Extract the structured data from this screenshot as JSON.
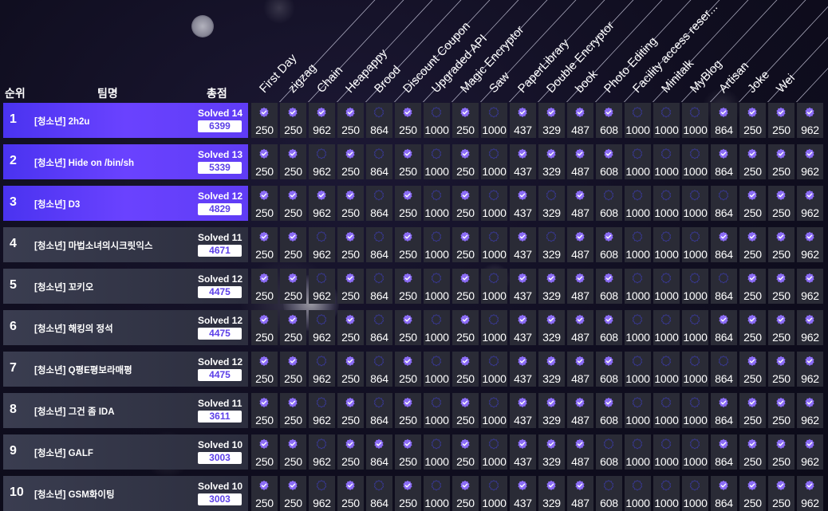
{
  "headers": {
    "rank": "순위",
    "team": "팀명",
    "score": "총점"
  },
  "challenges": [
    "First Day",
    "zigzag",
    "Chain",
    "Heapappy",
    "Brood",
    "Discount Coupon",
    "Upgraded API",
    "Magic Encryptor",
    "Saw",
    "PaperLibrary",
    "Double Encryptor",
    "book",
    "Photo Editing",
    "Facility access reser...",
    "Minitalk",
    "MyBlog",
    "Artisan",
    "Joke",
    "Wei"
  ],
  "points": [
    "250",
    "250",
    "962",
    "250",
    "864",
    "250",
    "1000",
    "250",
    "1000",
    "437",
    "329",
    "487",
    "608",
    "1000",
    "1000",
    "1000",
    "864",
    "250",
    "250",
    "962"
  ],
  "teams": [
    {
      "rank": "1",
      "name": "[청소년] 2h2u",
      "solved": "Solved 14",
      "score": "6399",
      "top": true,
      "solves": [
        1,
        1,
        1,
        1,
        0,
        1,
        0,
        1,
        0,
        1,
        1,
        1,
        1,
        0,
        0,
        0,
        1,
        1,
        1,
        1
      ]
    },
    {
      "rank": "2",
      "name": "[청소년] Hide on /bin/sh",
      "solved": "Solved 13",
      "score": "5339",
      "top": true,
      "solves": [
        1,
        1,
        0,
        1,
        0,
        1,
        0,
        1,
        0,
        1,
        1,
        1,
        1,
        0,
        0,
        0,
        1,
        1,
        1,
        1
      ]
    },
    {
      "rank": "3",
      "name": "[청소년] D3",
      "solved": "Solved 12",
      "score": "4829",
      "top": true,
      "solves": [
        1,
        1,
        1,
        1,
        0,
        1,
        0,
        1,
        0,
        1,
        0,
        1,
        0,
        0,
        0,
        0,
        0,
        1,
        1,
        1
      ]
    },
    {
      "rank": "4",
      "name": "[청소년] 마법소녀의시크릿익스",
      "solved": "Solved 11",
      "score": "4671",
      "top": false,
      "solves": [
        1,
        1,
        0,
        1,
        0,
        1,
        0,
        1,
        0,
        1,
        0,
        1,
        1,
        0,
        0,
        0,
        1,
        1,
        1,
        1
      ]
    },
    {
      "rank": "5",
      "name": "[청소년] 꼬키오",
      "solved": "Solved 12",
      "score": "4475",
      "top": false,
      "solves": [
        1,
        1,
        0,
        1,
        0,
        1,
        0,
        1,
        0,
        1,
        1,
        1,
        1,
        0,
        0,
        0,
        0,
        1,
        1,
        1
      ]
    },
    {
      "rank": "6",
      "name": "[청소년] 해킹의 정석",
      "solved": "Solved 12",
      "score": "4475",
      "top": false,
      "solves": [
        1,
        1,
        0,
        1,
        0,
        1,
        0,
        1,
        0,
        1,
        1,
        1,
        1,
        0,
        0,
        0,
        1,
        1,
        1,
        1
      ]
    },
    {
      "rank": "7",
      "name": "[청소년] Q평E평보라매평",
      "solved": "Solved 12",
      "score": "4475",
      "top": false,
      "solves": [
        1,
        1,
        0,
        1,
        0,
        1,
        0,
        1,
        0,
        1,
        1,
        1,
        1,
        0,
        0,
        0,
        0,
        1,
        1,
        1
      ]
    },
    {
      "rank": "8",
      "name": "[청소년] 그건 좀 IDA",
      "solved": "Solved 11",
      "score": "3611",
      "top": false,
      "solves": [
        1,
        1,
        0,
        1,
        0,
        1,
        0,
        1,
        0,
        1,
        1,
        1,
        1,
        0,
        0,
        0,
        1,
        1,
        1,
        1
      ]
    },
    {
      "rank": "9",
      "name": "[청소년] GALF",
      "solved": "Solved 10",
      "score": "3003",
      "top": false,
      "solves": [
        1,
        1,
        0,
        1,
        1,
        1,
        0,
        1,
        0,
        1,
        1,
        1,
        0,
        0,
        0,
        0,
        1,
        1,
        1,
        1
      ]
    },
    {
      "rank": "10",
      "name": "[청소년] GSM화이팅",
      "solved": "Solved 10",
      "score": "3003",
      "top": false,
      "solves": [
        1,
        1,
        0,
        1,
        0,
        1,
        0,
        1,
        0,
        1,
        1,
        1,
        0,
        0,
        0,
        0,
        1,
        1,
        1,
        1
      ]
    }
  ],
  "colors": {
    "accent": "#6a42ff",
    "solved_icon": "#8b6cf6",
    "unsolved_icon": "#3a3a9a",
    "cell_bg": "#2a2b36",
    "score_text": "#5c40e8"
  },
  "icons": {
    "solved": "check-badge-icon",
    "unsolved": "empty-badge-icon"
  }
}
